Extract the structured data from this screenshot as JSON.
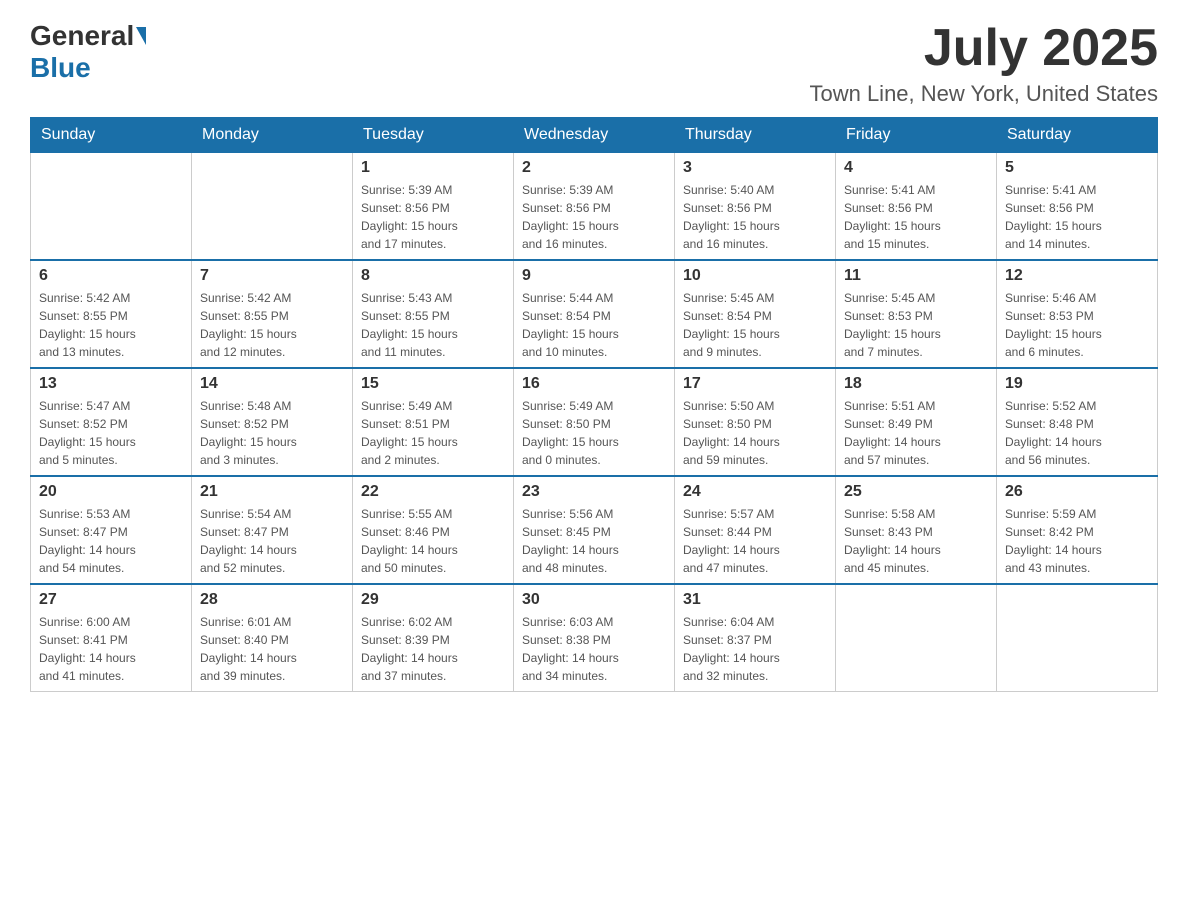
{
  "logo": {
    "general": "General",
    "blue": "Blue"
  },
  "header": {
    "month_year": "July 2025",
    "location": "Town Line, New York, United States"
  },
  "days_of_week": [
    "Sunday",
    "Monday",
    "Tuesday",
    "Wednesday",
    "Thursday",
    "Friday",
    "Saturday"
  ],
  "weeks": [
    [
      {
        "day": "",
        "info": ""
      },
      {
        "day": "",
        "info": ""
      },
      {
        "day": "1",
        "info": "Sunrise: 5:39 AM\nSunset: 8:56 PM\nDaylight: 15 hours\nand 17 minutes."
      },
      {
        "day": "2",
        "info": "Sunrise: 5:39 AM\nSunset: 8:56 PM\nDaylight: 15 hours\nand 16 minutes."
      },
      {
        "day": "3",
        "info": "Sunrise: 5:40 AM\nSunset: 8:56 PM\nDaylight: 15 hours\nand 16 minutes."
      },
      {
        "day": "4",
        "info": "Sunrise: 5:41 AM\nSunset: 8:56 PM\nDaylight: 15 hours\nand 15 minutes."
      },
      {
        "day": "5",
        "info": "Sunrise: 5:41 AM\nSunset: 8:56 PM\nDaylight: 15 hours\nand 14 minutes."
      }
    ],
    [
      {
        "day": "6",
        "info": "Sunrise: 5:42 AM\nSunset: 8:55 PM\nDaylight: 15 hours\nand 13 minutes."
      },
      {
        "day": "7",
        "info": "Sunrise: 5:42 AM\nSunset: 8:55 PM\nDaylight: 15 hours\nand 12 minutes."
      },
      {
        "day": "8",
        "info": "Sunrise: 5:43 AM\nSunset: 8:55 PM\nDaylight: 15 hours\nand 11 minutes."
      },
      {
        "day": "9",
        "info": "Sunrise: 5:44 AM\nSunset: 8:54 PM\nDaylight: 15 hours\nand 10 minutes."
      },
      {
        "day": "10",
        "info": "Sunrise: 5:45 AM\nSunset: 8:54 PM\nDaylight: 15 hours\nand 9 minutes."
      },
      {
        "day": "11",
        "info": "Sunrise: 5:45 AM\nSunset: 8:53 PM\nDaylight: 15 hours\nand 7 minutes."
      },
      {
        "day": "12",
        "info": "Sunrise: 5:46 AM\nSunset: 8:53 PM\nDaylight: 15 hours\nand 6 minutes."
      }
    ],
    [
      {
        "day": "13",
        "info": "Sunrise: 5:47 AM\nSunset: 8:52 PM\nDaylight: 15 hours\nand 5 minutes."
      },
      {
        "day": "14",
        "info": "Sunrise: 5:48 AM\nSunset: 8:52 PM\nDaylight: 15 hours\nand 3 minutes."
      },
      {
        "day": "15",
        "info": "Sunrise: 5:49 AM\nSunset: 8:51 PM\nDaylight: 15 hours\nand 2 minutes."
      },
      {
        "day": "16",
        "info": "Sunrise: 5:49 AM\nSunset: 8:50 PM\nDaylight: 15 hours\nand 0 minutes."
      },
      {
        "day": "17",
        "info": "Sunrise: 5:50 AM\nSunset: 8:50 PM\nDaylight: 14 hours\nand 59 minutes."
      },
      {
        "day": "18",
        "info": "Sunrise: 5:51 AM\nSunset: 8:49 PM\nDaylight: 14 hours\nand 57 minutes."
      },
      {
        "day": "19",
        "info": "Sunrise: 5:52 AM\nSunset: 8:48 PM\nDaylight: 14 hours\nand 56 minutes."
      }
    ],
    [
      {
        "day": "20",
        "info": "Sunrise: 5:53 AM\nSunset: 8:47 PM\nDaylight: 14 hours\nand 54 minutes."
      },
      {
        "day": "21",
        "info": "Sunrise: 5:54 AM\nSunset: 8:47 PM\nDaylight: 14 hours\nand 52 minutes."
      },
      {
        "day": "22",
        "info": "Sunrise: 5:55 AM\nSunset: 8:46 PM\nDaylight: 14 hours\nand 50 minutes."
      },
      {
        "day": "23",
        "info": "Sunrise: 5:56 AM\nSunset: 8:45 PM\nDaylight: 14 hours\nand 48 minutes."
      },
      {
        "day": "24",
        "info": "Sunrise: 5:57 AM\nSunset: 8:44 PM\nDaylight: 14 hours\nand 47 minutes."
      },
      {
        "day": "25",
        "info": "Sunrise: 5:58 AM\nSunset: 8:43 PM\nDaylight: 14 hours\nand 45 minutes."
      },
      {
        "day": "26",
        "info": "Sunrise: 5:59 AM\nSunset: 8:42 PM\nDaylight: 14 hours\nand 43 minutes."
      }
    ],
    [
      {
        "day": "27",
        "info": "Sunrise: 6:00 AM\nSunset: 8:41 PM\nDaylight: 14 hours\nand 41 minutes."
      },
      {
        "day": "28",
        "info": "Sunrise: 6:01 AM\nSunset: 8:40 PM\nDaylight: 14 hours\nand 39 minutes."
      },
      {
        "day": "29",
        "info": "Sunrise: 6:02 AM\nSunset: 8:39 PM\nDaylight: 14 hours\nand 37 minutes."
      },
      {
        "day": "30",
        "info": "Sunrise: 6:03 AM\nSunset: 8:38 PM\nDaylight: 14 hours\nand 34 minutes."
      },
      {
        "day": "31",
        "info": "Sunrise: 6:04 AM\nSunset: 8:37 PM\nDaylight: 14 hours\nand 32 minutes."
      },
      {
        "day": "",
        "info": ""
      },
      {
        "day": "",
        "info": ""
      }
    ]
  ]
}
